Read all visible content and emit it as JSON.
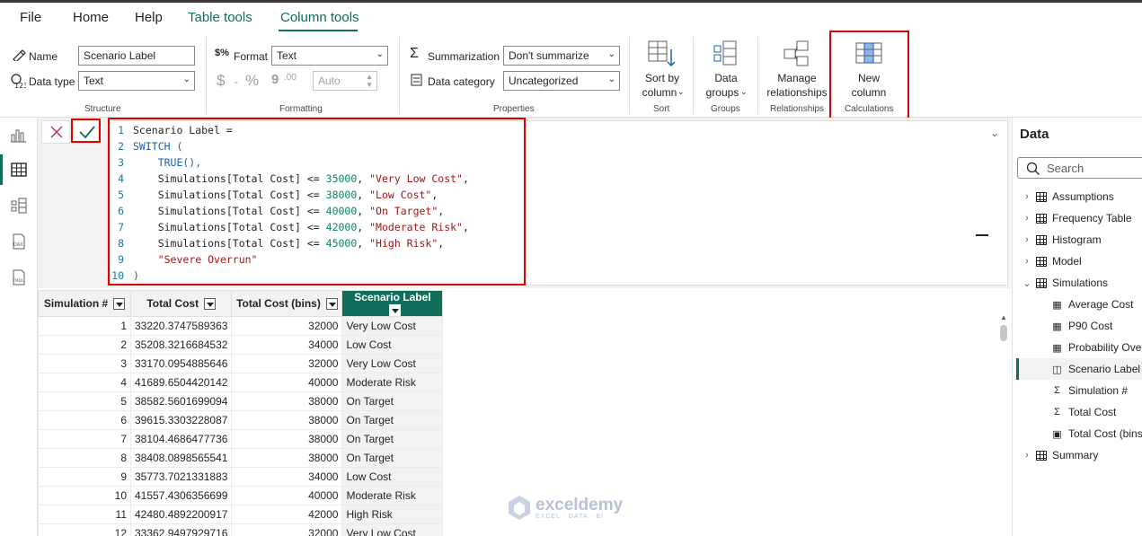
{
  "menu": {
    "file": "File",
    "home": "Home",
    "help": "Help",
    "table_tools": "Table tools",
    "column_tools": "Column tools"
  },
  "ribbon": {
    "structure": {
      "name_label": "Name",
      "name_value": "Scenario Label",
      "datatype_label": "Data type",
      "datatype_value": "Text",
      "group": "Structure"
    },
    "formatting": {
      "format_label": "Format",
      "format_value": "Text",
      "dollar": "$",
      "percent": "%",
      "comma": "9",
      "decimals": ".00",
      "auto": "Auto",
      "group": "Formatting"
    },
    "properties": {
      "summarization_label": "Summarization",
      "summarization_value": "Don't summarize",
      "category_label": "Data category",
      "category_value": "Uncategorized",
      "group": "Properties"
    },
    "sort": {
      "button_l1": "Sort by",
      "button_l2": "column",
      "group": "Sort"
    },
    "groups": {
      "button_l1": "Data",
      "button_l2": "groups",
      "group": "Groups"
    },
    "relationships": {
      "button_l1": "Manage",
      "button_l2": "relationships",
      "group": "Relationships"
    },
    "calculations": {
      "button_l1": "New",
      "button_l2": "column",
      "group": "Calculations"
    }
  },
  "formula": {
    "lines": [
      {
        "n": "1",
        "parts": [
          {
            "t": "Scenario Label =",
            "c": "fn-c"
          }
        ]
      },
      {
        "n": "2",
        "parts": [
          {
            "t": "SWITCH (",
            "c": "kw"
          }
        ]
      },
      {
        "n": "3",
        "parts": [
          {
            "t": "    TRUE(),",
            "c": "kw"
          }
        ]
      },
      {
        "n": "4",
        "parts": [
          {
            "t": "    Simulations[Total Cost] <= ",
            "c": "fn-c"
          },
          {
            "t": "35000",
            "c": "num"
          },
          {
            "t": ", ",
            "c": "fn-c"
          },
          {
            "t": "\"Very Low Cost\"",
            "c": "str"
          },
          {
            "t": ",",
            "c": "fn-c"
          }
        ]
      },
      {
        "n": "5",
        "parts": [
          {
            "t": "    Simulations[Total Cost] <= ",
            "c": "fn-c"
          },
          {
            "t": "38000",
            "c": "num"
          },
          {
            "t": ", ",
            "c": "fn-c"
          },
          {
            "t": "\"Low Cost\"",
            "c": "str"
          },
          {
            "t": ",",
            "c": "fn-c"
          }
        ]
      },
      {
        "n": "6",
        "parts": [
          {
            "t": "    Simulations[Total Cost] <= ",
            "c": "fn-c"
          },
          {
            "t": "40000",
            "c": "num"
          },
          {
            "t": ", ",
            "c": "fn-c"
          },
          {
            "t": "\"On Target\"",
            "c": "str"
          },
          {
            "t": ",",
            "c": "fn-c"
          }
        ]
      },
      {
        "n": "7",
        "parts": [
          {
            "t": "    Simulations[Total Cost] <= ",
            "c": "fn-c"
          },
          {
            "t": "42000",
            "c": "num"
          },
          {
            "t": ", ",
            "c": "fn-c"
          },
          {
            "t": "\"Moderate Risk\"",
            "c": "str"
          },
          {
            "t": ",",
            "c": "fn-c"
          }
        ]
      },
      {
        "n": "8",
        "parts": [
          {
            "t": "    Simulations[Total Cost] <= ",
            "c": "fn-c"
          },
          {
            "t": "45000",
            "c": "num"
          },
          {
            "t": ", ",
            "c": "fn-c"
          },
          {
            "t": "\"High Risk\"",
            "c": "str"
          },
          {
            "t": ",",
            "c": "fn-c"
          }
        ]
      },
      {
        "n": "9",
        "parts": [
          {
            "t": "    ",
            "c": "fn-c"
          },
          {
            "t": "\"Severe Overrun\"",
            "c": "str"
          }
        ]
      },
      {
        "n": "10",
        "parts": [
          {
            "t": ")",
            "c": "kw"
          }
        ]
      }
    ]
  },
  "table": {
    "headers": [
      "Simulation #",
      "Total Cost",
      "Total Cost (bins)",
      "Scenario Label"
    ],
    "rows": [
      [
        "1",
        "33220.3747589363",
        "32000",
        "Very Low Cost"
      ],
      [
        "2",
        "35208.3216684532",
        "34000",
        "Low Cost"
      ],
      [
        "3",
        "33170.0954885646",
        "32000",
        "Very Low Cost"
      ],
      [
        "4",
        "41689.6504420142",
        "40000",
        "Moderate Risk"
      ],
      [
        "5",
        "38582.5601699094",
        "38000",
        "On Target"
      ],
      [
        "6",
        "39615.3303228087",
        "38000",
        "On Target"
      ],
      [
        "7",
        "38104.4686477736",
        "38000",
        "On Target"
      ],
      [
        "8",
        "38408.0898565541",
        "38000",
        "On Target"
      ],
      [
        "9",
        "35773.7021331883",
        "34000",
        "Low Cost"
      ],
      [
        "10",
        "41557.4306356699",
        "40000",
        "Moderate Risk"
      ],
      [
        "11",
        "42480.4892200917",
        "42000",
        "High Risk"
      ],
      [
        "12",
        "33362.9497929716",
        "32000",
        "Very Low Cost"
      ]
    ]
  },
  "datapane": {
    "title": "Data",
    "search_placeholder": "Search",
    "tables": [
      {
        "name": "Assumptions",
        "expanded": false
      },
      {
        "name": "Frequency Table",
        "expanded": false
      },
      {
        "name": "Histogram",
        "expanded": false
      },
      {
        "name": "Model",
        "expanded": false
      },
      {
        "name": "Simulations",
        "expanded": true
      },
      {
        "name": "Summary",
        "expanded": false
      }
    ],
    "fields": [
      {
        "name": "Average Cost",
        "icon": "calculator-icon"
      },
      {
        "name": "P90 Cost",
        "icon": "calculator-icon"
      },
      {
        "name": "Probability Over",
        "icon": "calculator-icon"
      },
      {
        "name": "Scenario Label",
        "icon": "calculated-column-icon",
        "selected": true
      },
      {
        "name": "Simulation #",
        "icon": "sigma-icon"
      },
      {
        "name": "Total Cost",
        "icon": "sigma-icon"
      },
      {
        "name": "Total Cost (bins)",
        "icon": "bins-icon"
      }
    ]
  },
  "watermark": {
    "brand": "exceldemy",
    "tagline": "EXCEL · DATA · BI"
  },
  "colors": {
    "accent": "#106e5b",
    "highlight_red": "#e00000"
  }
}
